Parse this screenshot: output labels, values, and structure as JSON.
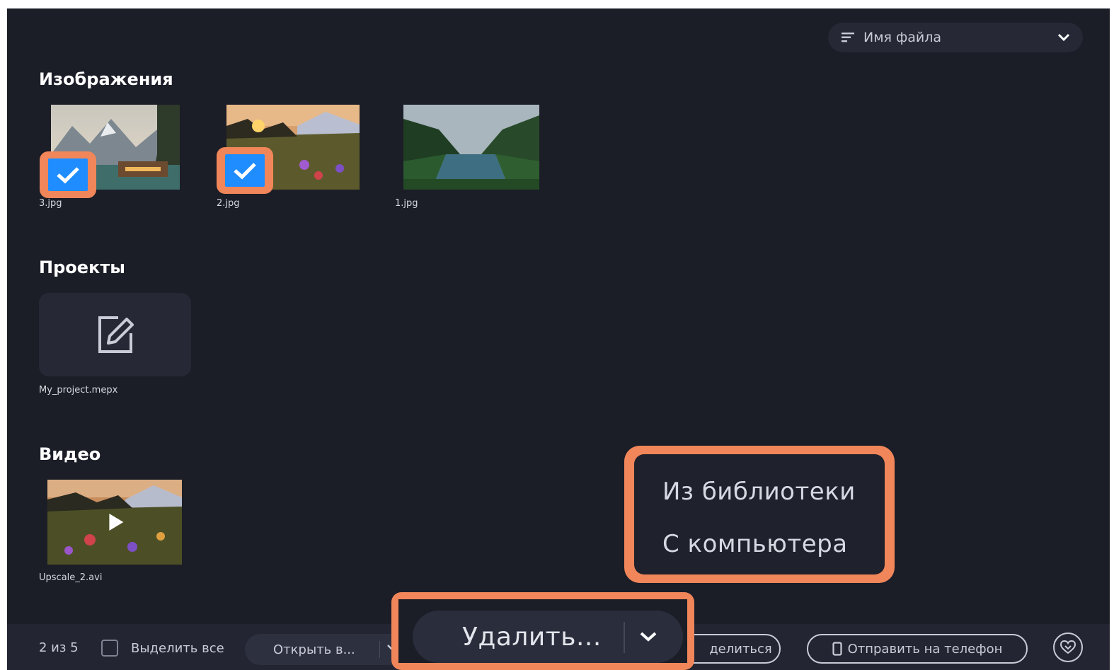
{
  "toolbar": {
    "sort_label": "Имя файла"
  },
  "sections": {
    "images": {
      "title": "Изображения",
      "items": [
        {
          "name": "3.jpg",
          "checked": true
        },
        {
          "name": "2.jpg",
          "checked": true
        },
        {
          "name": "1.jpg",
          "checked": false
        }
      ]
    },
    "projects": {
      "title": "Проекты",
      "items": [
        {
          "name": "My_project.mepx"
        }
      ]
    },
    "video": {
      "title": "Видео",
      "items": [
        {
          "name": "Upscale_2.avi"
        }
      ]
    }
  },
  "dropdown": {
    "items": [
      "Из библиотеки",
      "С компьютера"
    ]
  },
  "footer": {
    "count": "2 из 5",
    "select_all": "Выделить все",
    "open_in": "Открыть в...",
    "delete": "Удалить...",
    "share": "делиться",
    "send_to_phone": "Отправить на телефон"
  },
  "colors": {
    "background": "#1b1d27",
    "accent_check": "#1f8dff",
    "highlight": "#f08659"
  }
}
